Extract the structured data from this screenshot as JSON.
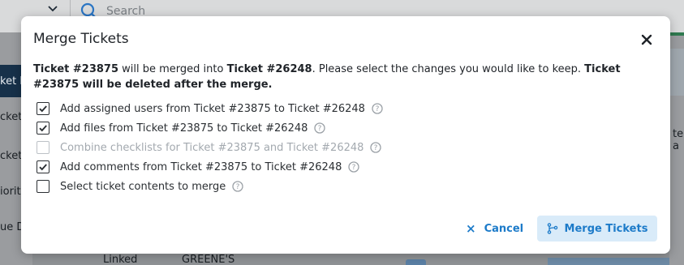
{
  "background": {
    "search_placeholder": "Search",
    "left_labels": [
      "ket D",
      "cket",
      "cket",
      "iorit",
      "ue D"
    ],
    "right_fragment": "te a",
    "bottom_left": "Linked",
    "bottom_right": "GREENE'S"
  },
  "modal": {
    "title": "Merge Tickets",
    "description": {
      "source_ticket": "Ticket #23875",
      "merge_text": " will be merged into ",
      "target_ticket": "Ticket #26248",
      "select_text": ". Please select the changes you would like to keep. ",
      "warning": "Ticket #23875 will be deleted after the merge."
    },
    "options": [
      {
        "label": "Add assigned users from Ticket #23875 to Ticket #26248",
        "checked": true,
        "disabled": false
      },
      {
        "label": "Add files from Ticket #23875 to Ticket #26248",
        "checked": true,
        "disabled": false
      },
      {
        "label": "Combine checklists for Ticket #23875 and Ticket #26248",
        "checked": false,
        "disabled": true
      },
      {
        "label": "Add comments from Ticket #23875 to Ticket #26248",
        "checked": true,
        "disabled": false
      },
      {
        "label": "Select ticket contents to merge",
        "checked": false,
        "disabled": false
      }
    ],
    "cancel_label": "Cancel",
    "merge_label": "Merge Tickets"
  },
  "colors": {
    "accent": "#1d7bc9",
    "primary_button_bg": "#d9ebf9",
    "sidebar_active": "#17314a"
  }
}
